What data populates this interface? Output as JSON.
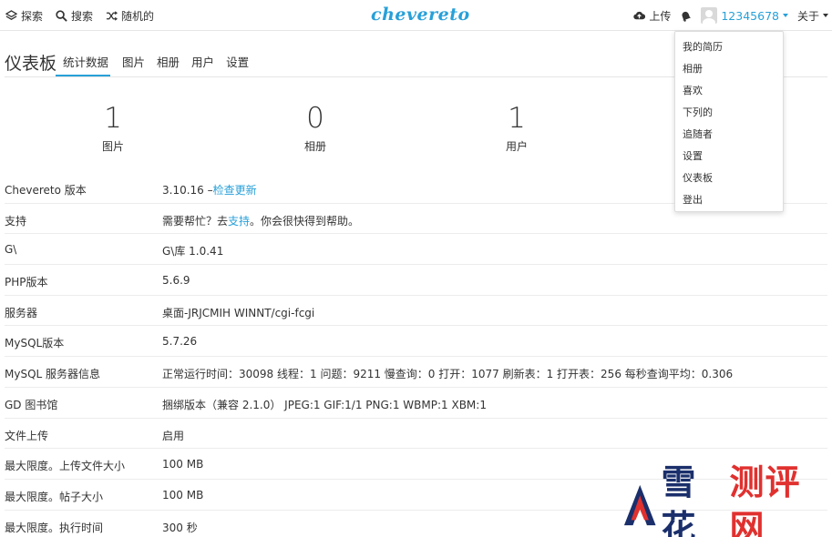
{
  "topbar": {
    "explore": "探索",
    "search": "搜索",
    "random": "随机的",
    "logo": "chevereto",
    "upload": "上传",
    "username": "12345678",
    "about": "关于"
  },
  "dashboard": {
    "title": "仪表板",
    "tabs": [
      "统计数据",
      "图片",
      "相册",
      "用户",
      "设置"
    ]
  },
  "stats": [
    {
      "value": "1",
      "label": "图片"
    },
    {
      "value": "0",
      "label": "相册"
    },
    {
      "value": "1",
      "label": "用户"
    }
  ],
  "rows": [
    {
      "key": "Chevereto 版本",
      "value": "3.10.16 –",
      "link": "检查更新"
    },
    {
      "key": "支持",
      "pre": "需要帮忙？去",
      "link": "支持",
      "post": "。你会很快得到帮助。"
    },
    {
      "key": "G\\",
      "link": "G\\库 1.0.41"
    },
    {
      "key": "PHP版本",
      "value": "5.6.9"
    },
    {
      "key": "服务器",
      "value": "桌面-JRJCMIH WINNT/cgi-fcgi"
    },
    {
      "key": "MySQL版本",
      "value": "5.7.26"
    },
    {
      "key": "MySQL 服务器信息",
      "value": "正常运行时间：30098 线程：1 问题：9211 慢查询：0 打开：1077 刷新表：1 打开表：256 每秒查询平均：0.306"
    },
    {
      "key": "GD 图书馆",
      "value": "捆绑版本（兼容 2.1.0） JPEG:1 GIF:1/1 PNG:1 WBMP:1 XBM:1"
    },
    {
      "key": "文件上传",
      "value": "启用"
    },
    {
      "key": "最大限度。上传文件大小",
      "value": "100 MB"
    },
    {
      "key": "最大限度。帖子大小",
      "value": "100 MB"
    },
    {
      "key": "最大限度。执行时间",
      "value": "300 秒"
    }
  ],
  "dropdown": [
    "我的简历",
    "相册",
    "喜欢",
    "下列的",
    "追随者",
    "设置",
    "仪表板",
    "登出"
  ],
  "watermark": {
    "part1": "雪花",
    "part2": "测评网"
  },
  "colors": {
    "accent": "#28a0d8",
    "watermark_blue": "#1a2f6b",
    "watermark_red": "#e0312f"
  }
}
